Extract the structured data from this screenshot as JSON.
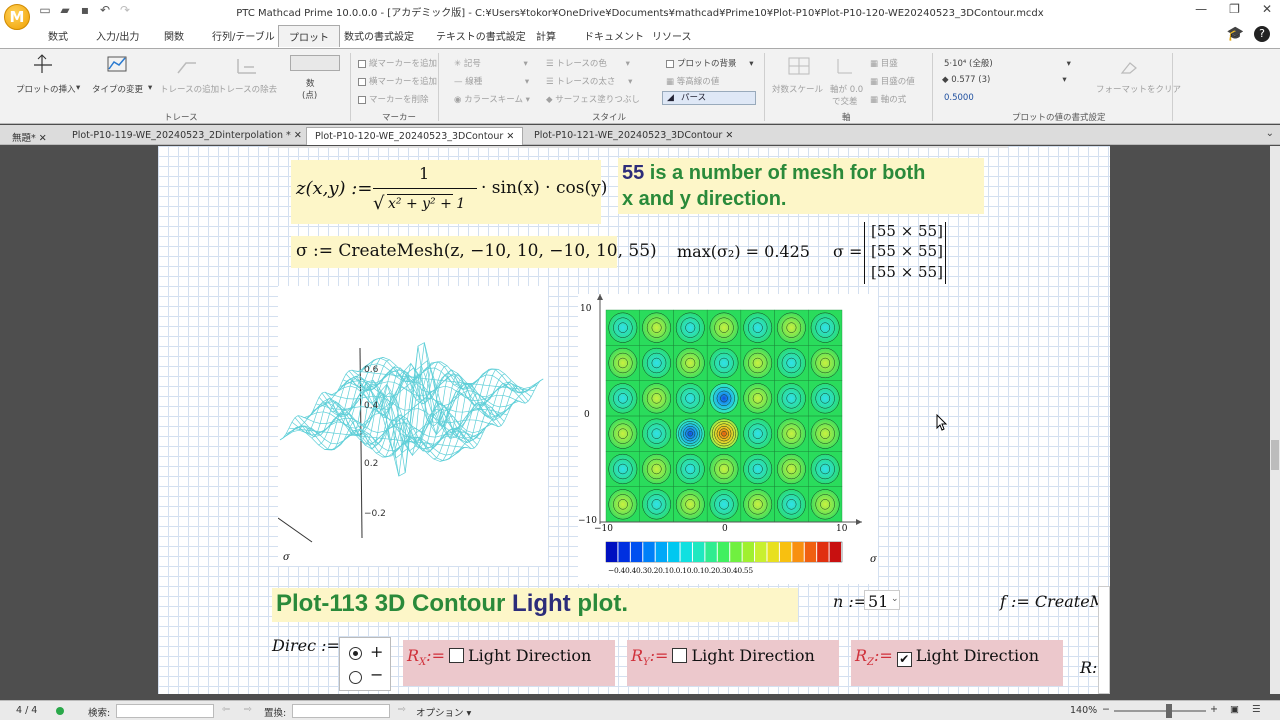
{
  "window": {
    "title": "PTC Mathcad Prime 10.0.0.0 - [アカデミック版] - C:¥Users¥tokor¥OneDrive¥Documents¥mathcad¥Prime10¥Plot-P10¥Plot-P10-120-WE20240523_3DContour.mcdx",
    "logo_letter": "M"
  },
  "ribbon_tabs": [
    "数式",
    "入力/出力",
    "関数",
    "行列/テーブル",
    "プロット",
    "数式の書式設定",
    "テキストの書式設定",
    "計算",
    "ドキュメント",
    "リソース"
  ],
  "ribbon_active_tab": "プロット",
  "ribbon": {
    "insert_plot": "プロットの挿入",
    "change_type": "タイプの変更",
    "add_trace": "トレースの追加",
    "remove_trace": "トレースの除去",
    "count_label_1": "数",
    "count_label_2": "(点)",
    "group_trace": "トレース",
    "v_marker": "縦マーカーを追加",
    "h_marker": "横マーカーを追加",
    "del_marker": "マーカーを削除",
    "group_marker": "マーカー",
    "symbol": "記号",
    "line": "線種",
    "colorscheme": "カラースキーム",
    "trace_color": "トレースの色",
    "trace_width": "トレースの太さ",
    "surface_fill": "サーフェス塗りつぶし",
    "plot_bg": "プロットの背景",
    "contour_value": "等高線の値",
    "perspective": "パース",
    "group_style": "スタイル",
    "log_scale": "対数スケール",
    "axis_cross_1": "軸が 0.0",
    "axis_cross_2": "で交差",
    "gridlines": "目盛",
    "grid_value": "目盛の値",
    "axis_expr": "軸の式",
    "group_axis": "軸",
    "fmt_value": "5·10⁴ (全般)",
    "fmt_precision": "0.577 (3)",
    "fmt_example": "0.5000",
    "clear_format": "フォーマットをクリア",
    "group_plot_format": "プロットの値の書式設定"
  },
  "doc_tabs": [
    {
      "label": "無題*",
      "active": false
    },
    {
      "label": "Plot-P10-119-WE_20240523_2Dinterpolation *",
      "active": false
    },
    {
      "label": "Plot-P10-120-WE_20240523_3DContour",
      "active": true
    },
    {
      "label": "Plot-P10-121-WE_20240523_3DContour",
      "active": false
    }
  ],
  "worksheet": {
    "z_def_lhs": "z(x,y) :=",
    "z_def_num": "1",
    "z_def_den": "x² + y² + 1",
    "z_def_tail": "· sin(x) · cos(y)",
    "note_num": "55",
    "note_rest_1": " is a number of mesh for both",
    "note_rest_2": "x and y direction.",
    "sigma_def": "σ := CreateMesh(z, −10, 10, −10, 10, 55)",
    "max_expr": "max(σ₂) = 0.425",
    "sigma_eq": "σ =",
    "sigma_rows": [
      "[55 × 55]",
      "[55 × 55]",
      "[55 × 55]"
    ],
    "plot3d_ticks": [
      "0.6",
      "0.4",
      "0.2",
      "−0.2"
    ],
    "plot3d_label": "σ",
    "contour_label": "σ",
    "contour_y_ticks": [
      "10",
      "0",
      "−10"
    ],
    "contour_x_ticks": [
      "−10",
      "0",
      "10"
    ],
    "colorbar_text": "−0.40.40.30.20.10.0.10.0.10.20.30.40.55",
    "heading_part1": "Plot-113 3D Contour ",
    "heading_part2": "Light",
    "heading_part3": " plot.",
    "n_def": "n :=",
    "n_value": "51",
    "f_def": "f := CreateM",
    "direc": "Direc :=",
    "radio_plus": "+",
    "radio_minus": "−",
    "rx_label": "R",
    "rx_sub": "X",
    "ry_label": "R",
    "ry_sub": "Y",
    "rz_label": "R",
    "rz_sub": "Z",
    "assign": ":=",
    "light_direction": "Light Direction",
    "r_edge": "R:"
  },
  "statusbar": {
    "page": "4 / 4",
    "search_label": "検索:",
    "replace_label": "置換:",
    "options": "オプション",
    "zoom": "140%"
  },
  "colors": {
    "green_text": "#2a8a3a",
    "navy_text": "#2c2c7a",
    "yellow_region": "#fdf6c8",
    "pink_region": "#ecc8cc",
    "surface": "#5fcfd8"
  }
}
